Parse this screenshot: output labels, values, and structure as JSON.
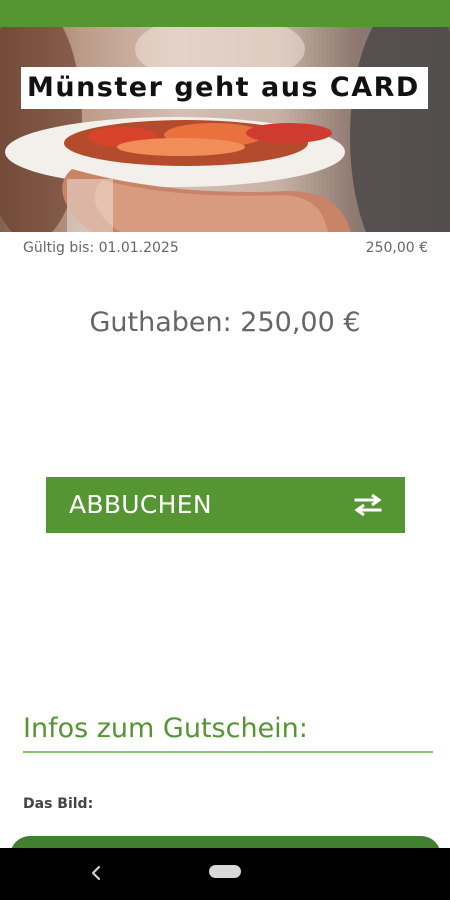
{
  "card": {
    "title": "Münster geht aus CARD",
    "valid_until": "Gültig bis: 01.01.2025",
    "amount": "250,00 €"
  },
  "balance": {
    "text": "Guthaben: 250,00 €"
  },
  "actions": {
    "debit_label": "ABBUCHEN",
    "debit_icon": "swap-arrows-icon"
  },
  "info": {
    "heading": "Infos zum Gutschein:",
    "image_label": "Das Bild:"
  },
  "colors": {
    "accent": "#559633",
    "accent_dark": "#3f7f2e",
    "muted_text": "#666666"
  },
  "navigation": {
    "back_icon": "back-chevron-icon",
    "home_icon": "home-pill-icon"
  }
}
